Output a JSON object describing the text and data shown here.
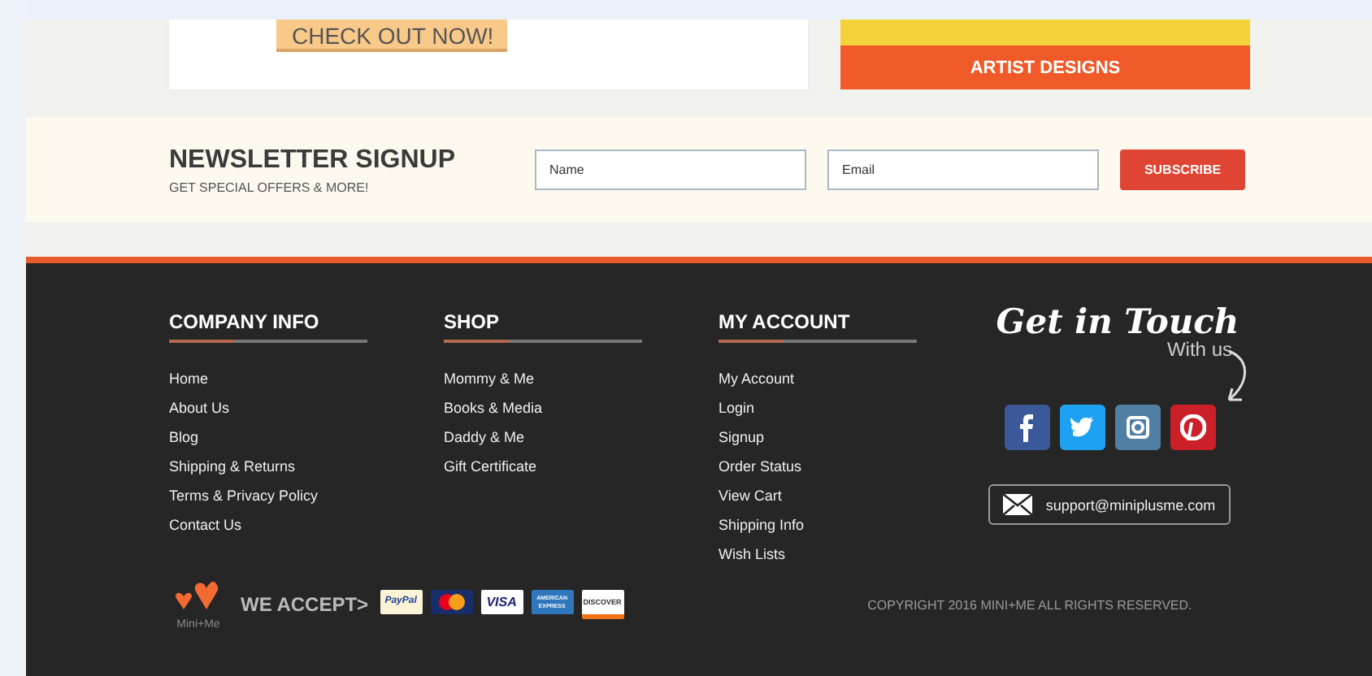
{
  "promo": {
    "button": "CHECK OUT NOW!",
    "banner": "ARTIST DESIGNS"
  },
  "newsletter": {
    "title": "NEWSLETTER SIGNUP",
    "subtitle": "GET SPECIAL OFFERS & MORE!",
    "name_placeholder": "Name",
    "email_placeholder": "Email",
    "button": "SUBSCRIBE"
  },
  "footer": {
    "columns": [
      {
        "title": "COMPANY INFO",
        "links": [
          "Home",
          "About Us",
          "Blog",
          "Shipping & Returns",
          "Terms & Privacy Policy",
          "Contact Us"
        ]
      },
      {
        "title": "SHOP",
        "links": [
          "Mommy & Me",
          "Books & Media",
          "Daddy & Me",
          "Gift Certificate"
        ]
      },
      {
        "title": "MY ACCOUNT",
        "links": [
          "My Account",
          "Login",
          "Signup",
          "Order Status",
          "View Cart",
          "Shipping Info",
          "Wish Lists"
        ]
      }
    ],
    "contact": {
      "title": "Get in Touch",
      "subtitle": "With us",
      "social": [
        {
          "kind": "facebook",
          "color": "#3b5998"
        },
        {
          "kind": "twitter",
          "color": "#1da1f2"
        },
        {
          "kind": "instagram",
          "color": "#517fa4"
        },
        {
          "kind": "pinterest",
          "color": "#cb2027"
        }
      ],
      "email": "support@miniplusme.com"
    },
    "logo": "Mini+Me",
    "accept": "WE ACCEPT>",
    "cards": [
      {
        "kind": "paypal",
        "label": "PayPal"
      },
      {
        "kind": "mastercard"
      },
      {
        "kind": "visa",
        "label": "VISA"
      },
      {
        "kind": "amex",
        "label": "AMERICAN EXPRESS"
      },
      {
        "kind": "discover",
        "label": "DISCOVER"
      }
    ],
    "copyright": "COPYRIGHT 2016 MINI+ME ALL RIGHTS RESERVED."
  }
}
